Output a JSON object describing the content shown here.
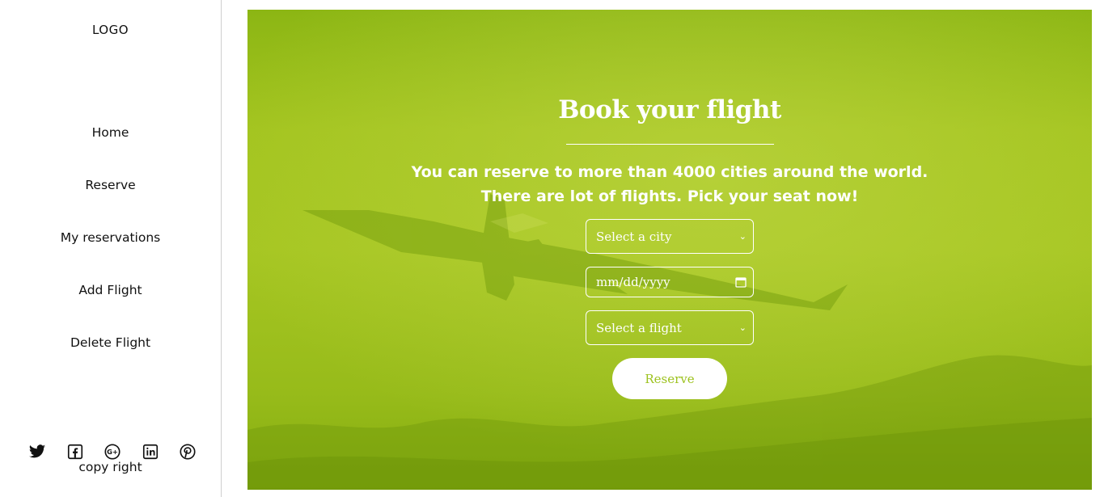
{
  "sidebar": {
    "logo": "LOGO",
    "nav": [
      {
        "label": "Home"
      },
      {
        "label": "Reserve"
      },
      {
        "label": "My reservations"
      },
      {
        "label": "Add Flight"
      },
      {
        "label": "Delete Flight"
      }
    ],
    "socials": [
      "twitter-icon",
      "facebook-icon",
      "google-plus-icon",
      "linkedin-icon",
      "pinterest-icon"
    ],
    "copyright": "copy right"
  },
  "hero": {
    "title": "Book your flight",
    "subtitle_line1": "You can reserve to more than 4000 cities around the world.",
    "subtitle_line2": "There are lot of flights. Pick your seat now!",
    "city_select": "Select a city",
    "date_input": "mm/dd/yyyy",
    "flight_select": "Select a flight",
    "reserve_label": "Reserve",
    "colors": {
      "overlay": "#a3c41f",
      "button_text": "#9dc21e"
    }
  }
}
